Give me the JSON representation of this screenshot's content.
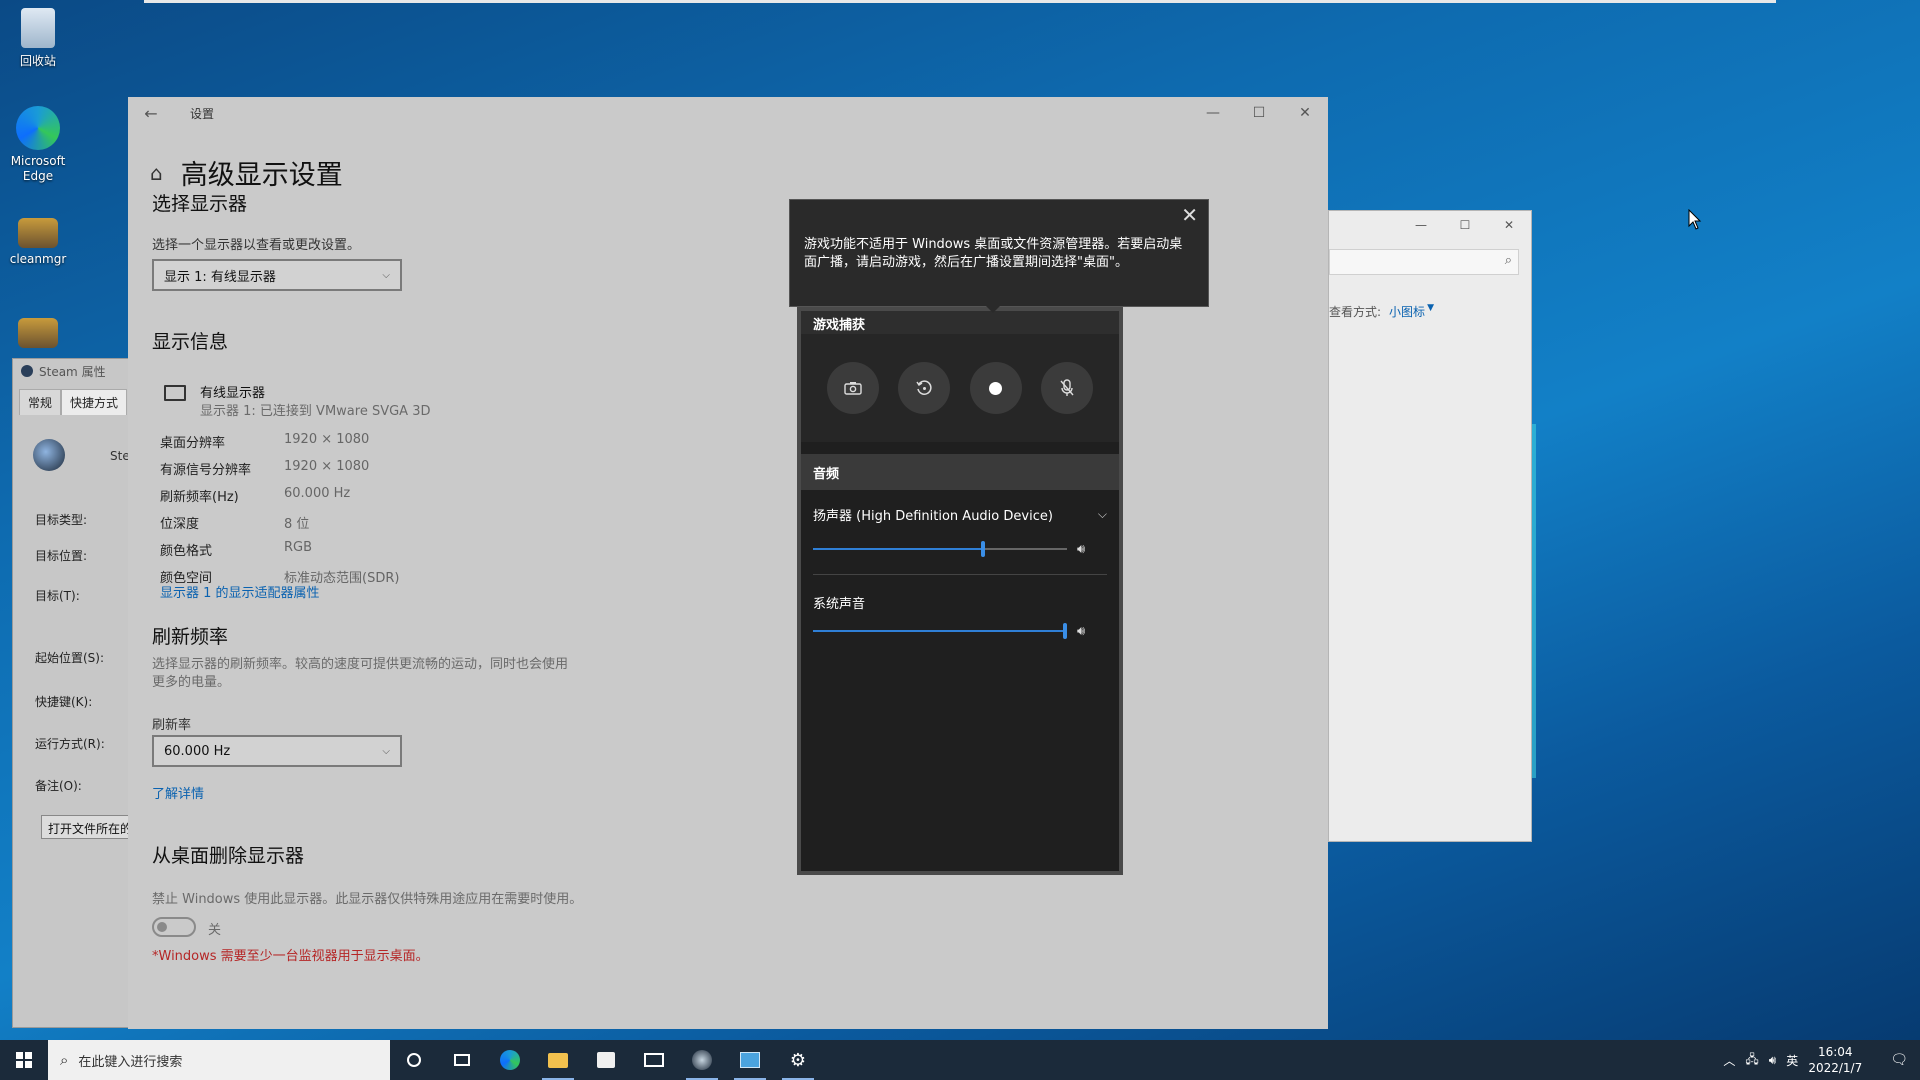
{
  "desktop": {
    "icons": [
      {
        "label": "回收站"
      },
      {
        "label": "Microsoft Edge"
      },
      {
        "label": "cleanmgr"
      },
      {
        "label": ""
      }
    ]
  },
  "steam_window": {
    "title": "Steam 属性",
    "tabs": [
      "常规",
      "快捷方式"
    ],
    "app_label": "Ste",
    "fields": [
      "目标类型:",
      "目标位置:",
      "目标(T):",
      "起始位置(S):",
      "快捷键(K):",
      "运行方式(R):",
      "备注(O):"
    ],
    "open_button": "打开文件所在的"
  },
  "control_panel": {
    "view_by_label": "查看方式:",
    "view_by_value": "小图标"
  },
  "settings": {
    "window_title": "设置",
    "page_title": "高级显示设置",
    "select_display": {
      "heading": "选择显示器",
      "description": "选择一个显示器以查看或更改设置。",
      "selected": "显示 1: 有线显示器"
    },
    "display_info": {
      "heading": "显示信息",
      "monitor_name": "有线显示器",
      "monitor_sub": "显示器 1: 已连接到 VMware SVGA 3D",
      "rows": [
        {
          "k": "桌面分辨率",
          "v": "1920 × 1080"
        },
        {
          "k": "有源信号分辨率",
          "v": "1920 × 1080"
        },
        {
          "k": "刷新频率(Hz)",
          "v": "60.000 Hz"
        },
        {
          "k": "位深度",
          "v": "8 位"
        },
        {
          "k": "颜色格式",
          "v": "RGB"
        },
        {
          "k": "颜色空间",
          "v": "标准动态范围(SDR)"
        }
      ],
      "adapter_link": "显示器 1 的显示适配器属性"
    },
    "refresh": {
      "heading": "刷新频率",
      "description_line1": "选择显示器的刷新频率。较高的速度可提供更流畅的运动，同时也会使用",
      "description_line2": "更多的电量。",
      "label": "刷新率",
      "selected": "60.000 Hz",
      "learn_more": "了解详情"
    },
    "remove": {
      "heading": "从桌面删除显示器",
      "description": "禁止 Windows 使用此显示器。此显示器仅供特殊用途应用在需要时使用。",
      "toggle_state": "关",
      "warning": "*Windows 需要至少一台监视器用于显示桌面。"
    }
  },
  "gamebar": {
    "tooltip": "游戏功能不适用于 Windows 桌面或文件资源管理器。若要启动桌面广播，请启动游戏，然后在广播设置期间选择\"桌面\"。",
    "capture_heading": "游戏捕获",
    "audio_heading": "音频",
    "device_name": "扬声器 (High Definition Audio Device)",
    "device_volume": 0.67,
    "system_label": "系统声音",
    "system_volume": 1.0
  },
  "taskbar": {
    "search_placeholder": "在此键入进行搜索",
    "time": "16:04",
    "date": "2022/1/7",
    "ime": "英"
  }
}
